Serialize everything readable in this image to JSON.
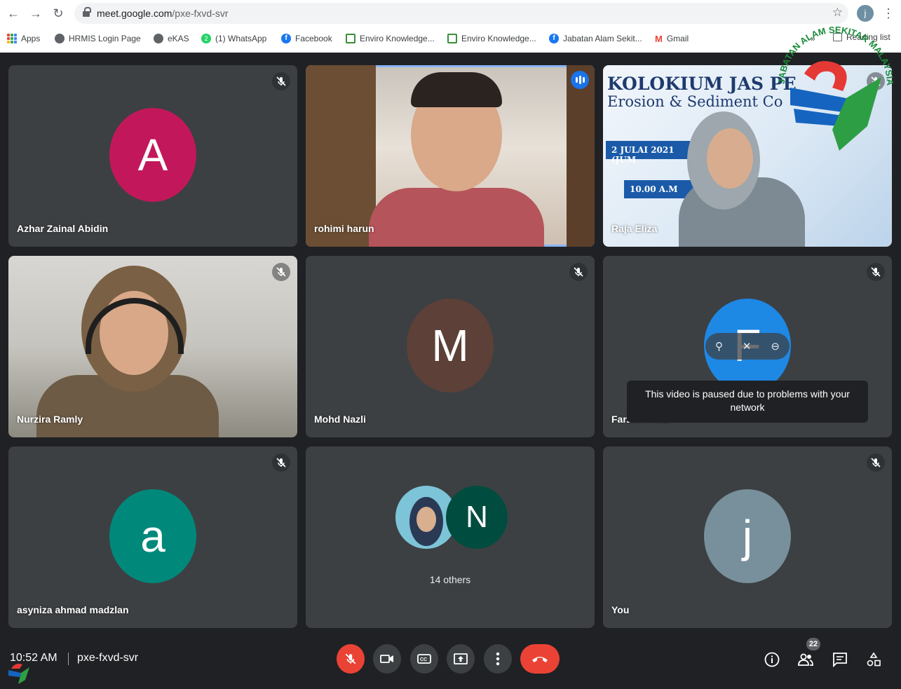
{
  "browser": {
    "url_host": "meet.google.com",
    "url_path": "/pxe-fxvd-svr",
    "profile_initial": "j",
    "bookmarks": [
      {
        "label": "Apps",
        "icon": "apps-grid-icon"
      },
      {
        "label": "HRMIS Login Page",
        "icon": "globe-icon"
      },
      {
        "label": "eKAS",
        "icon": "globe-icon"
      },
      {
        "label": "(1) WhatsApp",
        "icon": "whatsapp-icon"
      },
      {
        "label": "Facebook",
        "icon": "facebook-icon"
      },
      {
        "label": "Enviro Knowledge...",
        "icon": "enviro-icon"
      },
      {
        "label": "Enviro Knowledge...",
        "icon": "enviro-icon"
      },
      {
        "label": "Jabatan Alam Sekit...",
        "icon": "facebook-icon"
      },
      {
        "label": "Gmail",
        "icon": "gmail-icon"
      }
    ],
    "overflow": "»",
    "reading_list": "Reading list"
  },
  "logo": {
    "text": "JABATAN ALAM SEKITAR MALAYSIA"
  },
  "tiles": [
    {
      "name": "Azhar Zainal Abidin",
      "initial": "A",
      "color": "#c2185b",
      "muted": true
    },
    {
      "name": "rohimi harun",
      "video": true,
      "speaking": true
    },
    {
      "name": "Raja Eliza",
      "video": true,
      "muted": true,
      "slide_title": "KOLOKIUM JAS PE",
      "slide_subtitle": "Erosion & Sediment Co",
      "slide_date": "2 JULAI 2021 (JUM",
      "slide_time": "10.00 A.M"
    },
    {
      "name": "Nurzira Ramly",
      "video": true,
      "muted": true
    },
    {
      "name": "Mohd Nazli",
      "initial": "M",
      "color": "#5d4037",
      "muted": true
    },
    {
      "name": "Farzilla AMZ",
      "initial": "F",
      "color": "#1e88e5",
      "muted": true,
      "paused_message": "This video is paused due to problems with your network"
    },
    {
      "name": "asyniza ahmad madzlan",
      "initial": "a",
      "color": "#00897b",
      "muted": true
    },
    {
      "others_label": "14 others",
      "others_initial": "N",
      "others_color": "#004d40"
    },
    {
      "name": "You",
      "initial": "j",
      "color": "#78909c",
      "muted": true
    }
  ],
  "bottom": {
    "time": "10:52 AM",
    "meeting_code": "pxe-fxvd-svr",
    "participants_count": "22"
  }
}
